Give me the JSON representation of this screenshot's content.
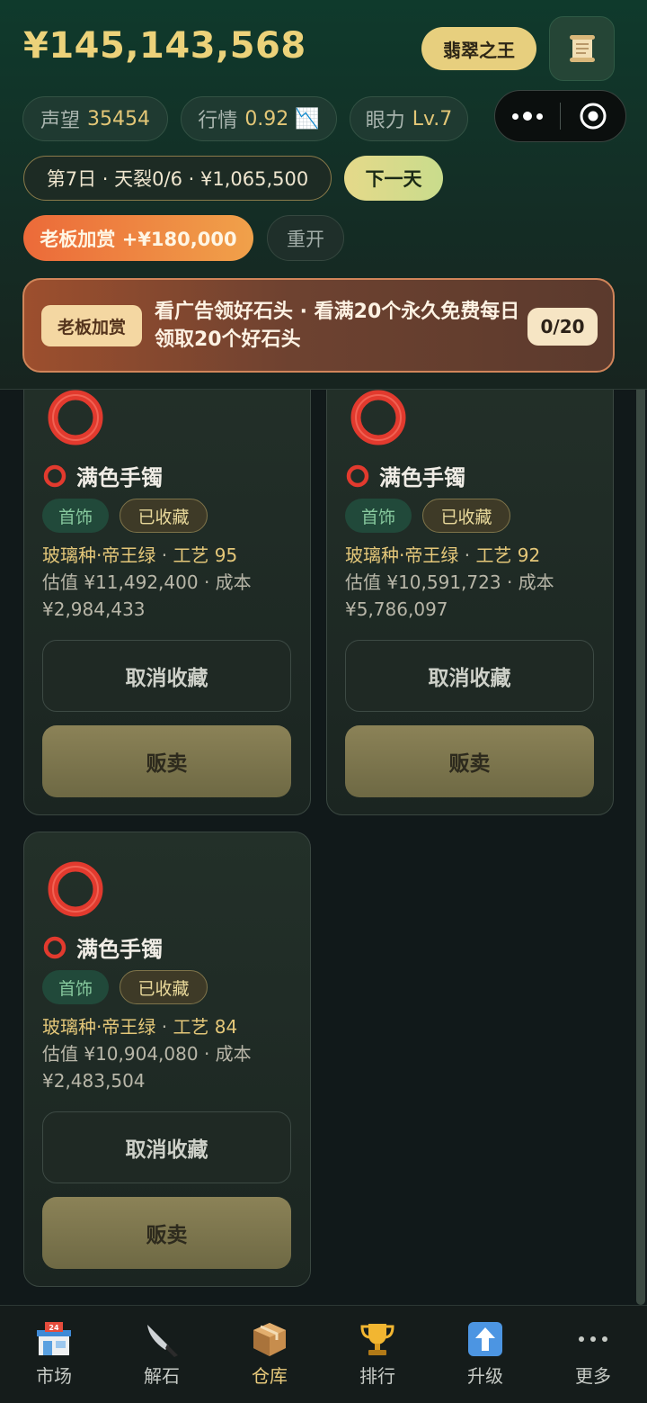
{
  "header": {
    "balance": "¥145,143,568",
    "title_badge": "翡翠之王",
    "stats": [
      {
        "label": "声望",
        "value": "35454"
      },
      {
        "label": "行情",
        "value": "0.92 📉"
      },
      {
        "label": "眼力",
        "value": "Lv.7"
      }
    ],
    "day_info": "第7日 · 天裂0/6 · ¥1,065,500",
    "next_day_label": "下一天",
    "boss_bonus_label": "老板加赏 +¥180,000",
    "restart_label": "重开"
  },
  "banner": {
    "tag": "老板加赏",
    "text": "看广告领好石头 · 看满20个永久免费每日领取20个好石头",
    "count": "0/20"
  },
  "items": [
    {
      "name": "满色手镯",
      "category": "首饰",
      "fav_state": "已收藏",
      "quality": "玻璃种·帝王绿",
      "craft": "工艺 95",
      "value_line": "估值 ¥11,492,400 · 成本",
      "cost": "¥2,984,433",
      "unfav_label": "取消收藏",
      "sell_label": "贩卖"
    },
    {
      "name": "满色手镯",
      "category": "首饰",
      "fav_state": "已收藏",
      "quality": "玻璃种·帝王绿",
      "craft": "工艺 92",
      "value_line": "估值 ¥10,591,723 · 成本",
      "cost": "¥5,786,097",
      "unfav_label": "取消收藏",
      "sell_label": "贩卖"
    },
    {
      "name": "满色手镯",
      "category": "首饰",
      "fav_state": "已收藏",
      "quality": "玻璃种·帝王绿",
      "craft": "工艺 84",
      "value_line": "估值 ¥10,904,080 · 成本",
      "cost": "¥2,483,504",
      "unfav_label": "取消收藏",
      "sell_label": "贩卖"
    }
  ],
  "nav": [
    {
      "label": "市场",
      "icon": "convenience-store-icon"
    },
    {
      "label": "解石",
      "icon": "knife-icon"
    },
    {
      "label": "仓库",
      "icon": "package-icon",
      "active": true
    },
    {
      "label": "排行",
      "icon": "trophy-icon"
    },
    {
      "label": "升级",
      "icon": "up-arrow-icon"
    },
    {
      "label": "更多",
      "icon": "more-dots-icon"
    }
  ],
  "colors": {
    "gold": "#ecd27a",
    "header_green": "#0f3a2c",
    "sell_button": "#8b8257",
    "category_tag": "#21493a",
    "boss_orange": "#ec6a39"
  }
}
